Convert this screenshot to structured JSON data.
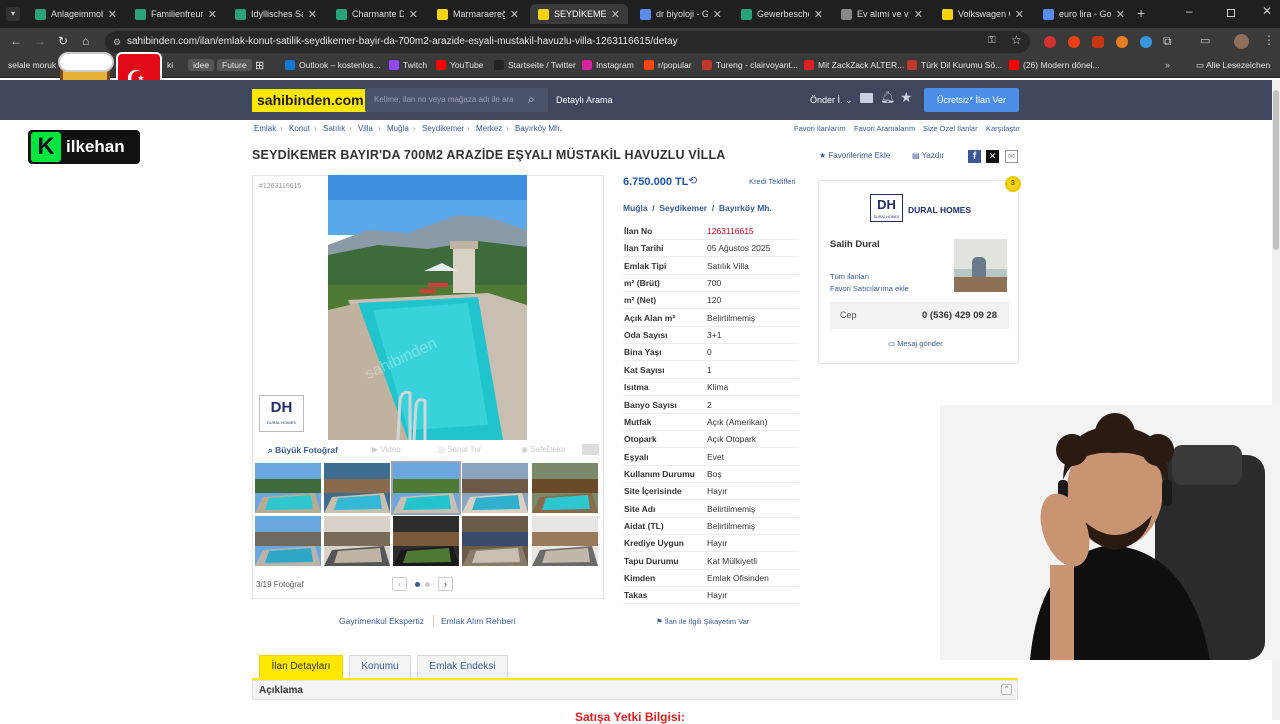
{
  "browser": {
    "tabs": [
      {
        "label": "Anlageimmob",
        "color": "#2aa37a"
      },
      {
        "label": "Familienfreund",
        "color": "#2aa37a"
      },
      {
        "label": "Idyllisches San",
        "color": "#2aa37a"
      },
      {
        "label": "Charmante Do",
        "color": "#2aa37a"
      },
      {
        "label": "Marmaraereğli",
        "color": "#f5d40f"
      },
      {
        "label": "SEYDİKEMER B",
        "color": "#f5d40f"
      },
      {
        "label": "dr biyoloji - Go",
        "color": "#5b8def"
      },
      {
        "label": "Gewerbeschein",
        "color": "#2aa37a"
      },
      {
        "label": "Ev alımı ve vere",
        "color": "#888888"
      },
      {
        "label": "Volkswagen Ca",
        "color": "#f5d40f"
      },
      {
        "label": "euro lira - Goo",
        "color": "#5b8def"
      }
    ],
    "url": "sahibinden.com/ilan/emlak-konut-satilik-seydikemer-bayir-da-700m2-arazide-esyali-mustakil-havuzlu-villa-1263116615/detay",
    "bookmarks": [
      {
        "label": "selale moruk",
        "color": ""
      },
      {
        "label": "ki",
        "color": ""
      },
      {
        "label": "idee",
        "color": ""
      },
      {
        "label": "Future",
        "color": ""
      },
      {
        "label": "Outlook – kostenlos...",
        "color": "#1479d4"
      },
      {
        "label": "Twitch",
        "color": "#9146ff"
      },
      {
        "label": "YouTube",
        "color": "#ff0000"
      },
      {
        "label": "Startseite / Twitter",
        "color": "#222"
      },
      {
        "label": "Instagram",
        "color": "#d6249f"
      },
      {
        "label": "r/popular",
        "color": "#ff4500"
      },
      {
        "label": "Tureng - clairvoyant...",
        "color": "#c0392b"
      },
      {
        "label": "Mit ZackZack ALTER...",
        "color": "#e02020"
      },
      {
        "label": "Türk Dil Kurumu Sö...",
        "color": "#c0392b"
      },
      {
        "label": "(26) Modern dönel...",
        "color": "#ff0000"
      }
    ],
    "bookmarks_all": "Alle Lesezeichen"
  },
  "overlay": {
    "streamer_name": "ilkehan"
  },
  "header": {
    "logo": "sahibinden.com",
    "search_placeholder": "Kelime, ilan no veya mağaza adı ile ara",
    "detailed_search": "Detaylı Arama",
    "user": "Önder İ.",
    "cta": "Ücretsiz* İlan Ver"
  },
  "breadcrumbs": [
    "Emlak",
    "Konut",
    "Satılık",
    "Villa",
    "Muğla",
    "Seydikemer",
    "Merkez",
    "Bayırköy Mh."
  ],
  "top_links": [
    "Favori İlanlarım",
    "Favori Aramalarım",
    "Size Özel İlanlar",
    "Karşılaştır"
  ],
  "listing": {
    "title": "SEYDİKEMER BAYIR'DA 700M2 ARAZİDE EŞYALI MÜSTAKİL HAVUZLU VİLLA",
    "favorite": "Favorilerime Ekle",
    "print": "Yazdır",
    "listing_ref": "#1263116615",
    "price": "6.750.000 TL",
    "credit": "Kredi Teklifleri",
    "location": [
      "Muğla",
      "Seydikemer",
      "Bayırköy Mh."
    ],
    "details": [
      {
        "key": "İlan No",
        "value": "1263116615",
        "red": true
      },
      {
        "key": "İlan Tarihi",
        "value": "05 Ağustos 2025"
      },
      {
        "key": "Emlak Tipi",
        "value": "Satılık Villa"
      },
      {
        "key": "m² (Brüt)",
        "value": "700"
      },
      {
        "key": "m² (Net)",
        "value": "120"
      },
      {
        "key": "Açık Alan m²",
        "value": "Belirtilmemiş"
      },
      {
        "key": "Oda Sayısı",
        "value": "3+1"
      },
      {
        "key": "Bina Yaşı",
        "value": "0"
      },
      {
        "key": "Kat Sayısı",
        "value": "1"
      },
      {
        "key": "Isıtma",
        "value": "Klima"
      },
      {
        "key": "Banyo Sayısı",
        "value": "2"
      },
      {
        "key": "Mutfak",
        "value": "Açık (Amerikan)"
      },
      {
        "key": "Otopark",
        "value": "Açık Otopark"
      },
      {
        "key": "Eşyalı",
        "value": "Evet"
      },
      {
        "key": "Kullanım Durumu",
        "value": "Boş"
      },
      {
        "key": "Site İçerisinde",
        "value": "Hayır"
      },
      {
        "key": "Site Adı",
        "value": "Belirtilmemiş"
      },
      {
        "key": "Aidat (TL)",
        "value": "Belirtilmemiş"
      },
      {
        "key": "Krediye Uygun",
        "value": "Hayır"
      },
      {
        "key": "Tapu Durumu",
        "value": "Kat Mülkiyetli"
      },
      {
        "key": "Kimden",
        "value": "Emlak Ofisinden"
      },
      {
        "key": "Takas",
        "value": "Hayır"
      }
    ],
    "report": "İlan ile İlgili Şikayetim Var"
  },
  "photos": {
    "big_photo": "Büyük Fotoğraf",
    "video": "Video",
    "virtual_tour": "Sanal Tur",
    "counter": "3/19 Fotoğraf",
    "watermark": "sahibinden"
  },
  "links": [
    "Gayrimenkul Ekspertiz",
    "Emlak Alım Rehberi"
  ],
  "seller": {
    "agency": "DURAL HOMES",
    "agency_logo": "DH",
    "agency_sub": "DURAL HOMES",
    "name": "Salih Dural",
    "all_listings": "Tüm ilanları",
    "add_fav": "Favori Satıcılarıma ekle",
    "phone_label": "Cep",
    "phone": "0 (536) 429 09 28",
    "message": "Mesaj gönder",
    "years": "3"
  },
  "page_tabs": [
    "İlan Detayları",
    "Konumu",
    "Emlak Endeksi"
  ],
  "description": {
    "heading": "Açıklama",
    "subheading": "Satışa Yetki Bilgisi:"
  },
  "colors": {
    "brand_yellow": "#ffe800",
    "header_bg": "#3f475f",
    "link": "#385a99",
    "cta": "#4b8ee8"
  }
}
